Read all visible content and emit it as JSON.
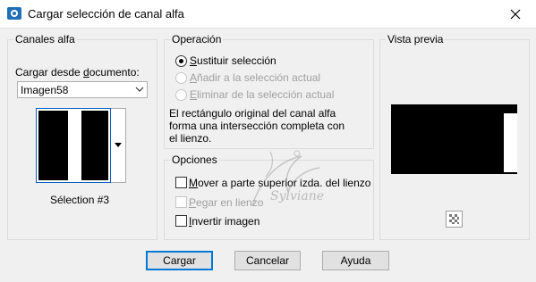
{
  "window": {
    "title": "Cargar selección de canal alfa"
  },
  "alpha_panel": {
    "title": "Canales alfa",
    "load_from_label_pre": "Cargar desde ",
    "load_from_label_ul": "d",
    "load_from_label_post": "ocumento:",
    "document_value": "Imagen58",
    "selection_name": "Sélection #3"
  },
  "operation": {
    "title": "Operación",
    "options": [
      {
        "ul": "S",
        "rest": "ustituir selección",
        "selected": true,
        "enabled": true
      },
      {
        "ul": "A",
        "rest": "ñadir a la selección actual",
        "selected": false,
        "enabled": false
      },
      {
        "ul": "E",
        "rest": "liminar de la selección actual",
        "selected": false,
        "enabled": false
      }
    ],
    "description_lines": [
      "El rectángulo original del canal alfa",
      "forma una intersección completa con",
      "el lienzo."
    ]
  },
  "options": {
    "title": "Opciones",
    "items": [
      {
        "ul": "M",
        "rest": "over a parte superior izda. del lienzo",
        "checked": false,
        "enabled": true
      },
      {
        "ul": "P",
        "rest": "egar en lienzo",
        "checked": false,
        "enabled": false
      },
      {
        "ul": "I",
        "rest": "nvertir imagen",
        "checked": false,
        "enabled": true
      }
    ]
  },
  "preview": {
    "title": "Vista previa"
  },
  "buttons": {
    "load": "Cargar",
    "cancel": "Cancelar",
    "help": "Ayuda"
  },
  "watermark_text": "Sylviane",
  "colors": {
    "accent": "#0078d7",
    "title_icon": "#1e6fb8"
  }
}
